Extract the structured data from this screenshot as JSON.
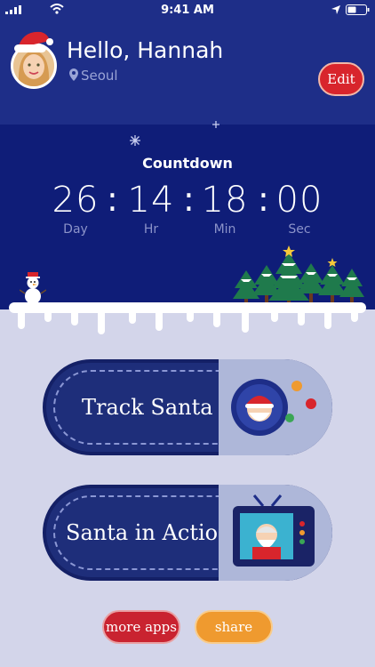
{
  "status_bar": {
    "time": "9:41 AM"
  },
  "header": {
    "greeting": "Hello, Hannah",
    "location": "Seoul",
    "edit_label": "Edit"
  },
  "countdown": {
    "title": "Countdown",
    "units": [
      {
        "value": "26",
        "label": "Day"
      },
      {
        "value": "14",
        "label": "Hr"
      },
      {
        "value": "18",
        "label": "Min"
      },
      {
        "value": "00",
        "label": "Sec"
      }
    ]
  },
  "actions": {
    "track": {
      "label": "Track Santa"
    },
    "action": {
      "label": "Santa in Action"
    }
  },
  "footer": {
    "more_label": "more apps",
    "share_label": "share"
  },
  "colors": {
    "header_bg": "#1e2e88",
    "scene_bg": "#0f1d78",
    "page_bg": "#d3d5ea",
    "accent_red": "#d8252c",
    "accent_orange": "#ef9a2f"
  },
  "icons": [
    "signal-icon",
    "wifi-icon",
    "location-arrow-icon",
    "battery-icon",
    "santa-hat-icon",
    "location-pin-icon",
    "snowflake-icon",
    "snowman-icon",
    "christmas-tree-icon",
    "santa-globe-icon",
    "tv-icon"
  ]
}
